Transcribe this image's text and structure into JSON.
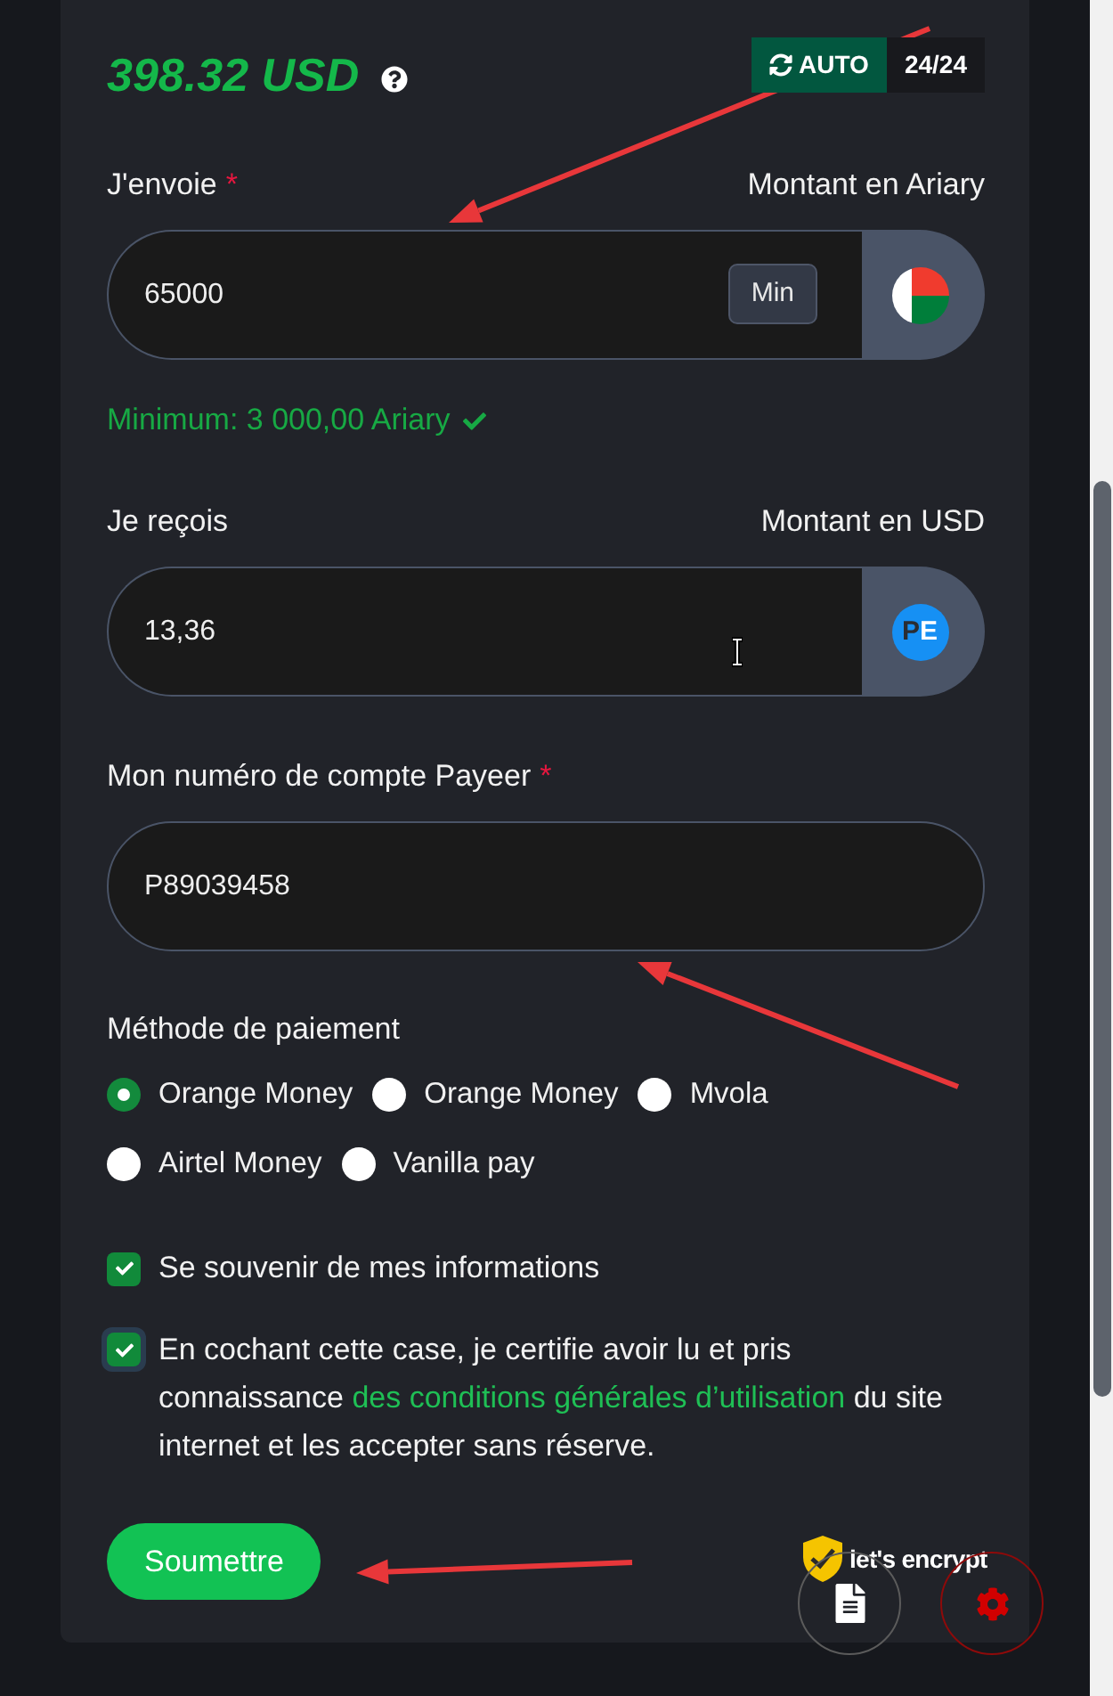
{
  "balance": {
    "amount": "398.32 USD"
  },
  "service_status": {
    "mode": "AUTO",
    "hours": "24/24"
  },
  "fields": [
    {
      "kind": "amount",
      "label": "J'envoie",
      "required_mark": "*",
      "unit_label": "Montant en Ariary",
      "value": "65000",
      "min_button": "Min",
      "addon": {
        "kind": "flag"
      },
      "note": {
        "text": "Minimum: 3 000,00 Ariary",
        "valid": true
      }
    },
    {
      "kind": "amount",
      "label": "Je reçois",
      "unit_label": "Montant en USD",
      "value": "13,36",
      "addon": {
        "kind": "logo",
        "letters": [
          "P",
          "E"
        ]
      }
    },
    {
      "kind": "text",
      "label": "Mon numéro de compte Payeer",
      "required_mark": "*",
      "value": "P89039458"
    }
  ],
  "payment_method": {
    "label": "Méthode de paiement",
    "options": [
      {
        "label": "Orange Money",
        "selected": true
      },
      {
        "label": "Orange Money",
        "selected": false
      },
      {
        "label": "Mvola",
        "selected": false
      },
      {
        "label": "Airtel Money",
        "selected": false
      },
      {
        "label": "Vanilla pay",
        "selected": false
      }
    ]
  },
  "checkboxes": [
    {
      "kind": "simple",
      "label": "Se souvenir de mes informations",
      "checked": true,
      "focused": false
    },
    {
      "kind": "terms",
      "text": "En cochant cette case, je certifie avoir lu et pris connaissance",
      "link": "des conditions générales d’utilisation",
      "text_after": "du site internet et les accepter sans réserve.",
      "checked": true,
      "focused": true
    }
  ],
  "submit_button": "Soumettre",
  "ssl_badge": "let's encrypt"
}
